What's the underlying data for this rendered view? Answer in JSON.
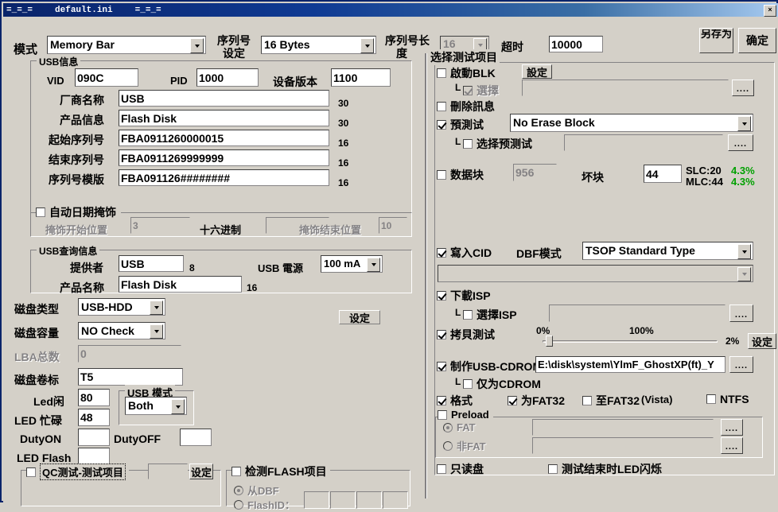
{
  "window": {
    "title_deco_left": "=_=_=",
    "title": "default.ini",
    "title_deco_right": "=_=_=",
    "close_label": "×"
  },
  "topbar": {
    "mode_label": "模式",
    "mode_value": "Memory Bar",
    "serial_device_label": "序列号设定",
    "serial_device_label_l1": "序列号",
    "serial_device_label_l2": "设定",
    "serial_device_value": "16 Bytes",
    "serial_len_label_l1": "序列号长",
    "serial_len_label_l2": "度",
    "serial_len_value": "16",
    "timeout_label": "超时",
    "timeout_value": "10000",
    "saveas_label": "另存为",
    "ok_label": "确定"
  },
  "usb_info": {
    "group_title": "USB信息",
    "vid_label": "VID",
    "vid_value": "090C",
    "pid_label": "PID",
    "pid_value": "1000",
    "devver_label": "设备版本",
    "devver_value": "1100",
    "rows": [
      {
        "label": "厂商名称",
        "value": "USB",
        "len": "30"
      },
      {
        "label": "产品信息",
        "value": "Flash Disk",
        "len": "30"
      },
      {
        "label": "起始序列号",
        "value": "FBA0911260000015",
        "len": "16"
      },
      {
        "label": "结束序列号",
        "value": "FBA0911269999999",
        "len": "16"
      },
      {
        "label": "序列号模版",
        "value": "FBA091126########",
        "len": "16"
      }
    ],
    "auto_date_mask_label": "自动日期掩饰",
    "auto_date_mask_checked": false,
    "mask_start_label": "掩饰开始位置",
    "mask_start_value": "3",
    "hex_label": "十六进制",
    "hex_value": "",
    "mask_end_label": "掩饰结束位置",
    "mask_end_value": "10"
  },
  "usb_query": {
    "group_title": "USB查询信息",
    "vendor_label": "提供者",
    "vendor_value": "USB",
    "vendor_len": "8",
    "product_label": "产品名称",
    "product_value": "Flash Disk",
    "product_len": "16",
    "power_label": "USB 電源",
    "power_value": "100 mA"
  },
  "disk": {
    "type_label": "磁盘类型",
    "type_value": "USB-HDD",
    "capacity_label": "磁盘容量",
    "capacity_value": "NO Check",
    "setting_button": "设定",
    "lba_label": "LBA总数",
    "lba_value": "0",
    "volume_label": "磁盘卷标",
    "volume_value": "T5",
    "led_idle_label": "Led闲",
    "led_idle_value": "80",
    "led_busy_label": "LED 忙碌",
    "led_busy_value": "48",
    "duty_on_label": "DutyON",
    "duty_on_value": "",
    "duty_off_label": "DutyOFF",
    "duty_off_value": "",
    "led_flash_label": "LED Flash",
    "led_flash_value": "",
    "usb_mode_group": "USB 模式",
    "usb_mode_value": "Both"
  },
  "qc": {
    "label": "QC测试-测试项目",
    "checked": false,
    "value": "",
    "setting_button": "设定"
  },
  "flash_detect": {
    "label": "检测FLASH项目",
    "checked": false,
    "from_dbf_label": "从DBF",
    "from_dbf_selected": true,
    "flashid_label": "FlashID：",
    "flashid_selected": false,
    "flashid_values": [
      "",
      "",
      "",
      ""
    ]
  },
  "test_items": {
    "group_title": "选择测试项目",
    "start_blk_label": "啟動BLK",
    "start_blk_checked": false,
    "start_blk_setting": "設定",
    "start_blk_path": "",
    "choose_label": "選擇",
    "choose_checked": true,
    "del_msg_label": "刪除訊息",
    "del_msg_checked": false,
    "pretest_label": "預測试",
    "pretest_checked": true,
    "pretest_value": "No Erase Block",
    "pretest_select_label": "选择预测试",
    "pretest_select_checked": false,
    "pretest_select_path": "",
    "browse_label": "....",
    "data_block_label": "数据块",
    "data_block_checked": false,
    "data_block_value": "956",
    "bad_block_label": "坏块",
    "bad_block_value": "44",
    "slc_label": "SLC:20",
    "slc_pct": "4.3%",
    "mlc_label": "MLC:44",
    "mlc_pct": "4.3%",
    "write_cid_label": "寫入CID",
    "write_cid_checked": true,
    "dbf_mode_label": "DBF模式",
    "dbf_mode_value": "TSOP Standard Type",
    "dbf_extra_value": "",
    "download_isp_label": "下載ISP",
    "download_isp_checked": true,
    "select_isp_label": "選擇ISP",
    "select_isp_checked": false,
    "select_isp_path": "",
    "copy_test_label": "拷貝測试",
    "copy_test_checked": true,
    "slider_min_label": "0%",
    "slider_max_label": "100%",
    "slider_value_label": "2%",
    "slider_value": 2,
    "copy_setting_button": "设定",
    "make_cdrom_label": "制作USB-CDROM",
    "make_cdrom_checked": true,
    "cdrom_path": "E:\\disk\\system\\YlmF_GhostXP(ft)_Y",
    "only_cdrom_label": "仅为CDROM",
    "only_cdrom_checked": false,
    "format_label": "格式",
    "format_checked": true,
    "to_fat32_label": "为FAT32",
    "to_fat32_checked": true,
    "to_fat32_vista_label": "至FAT32",
    "vista_label": "(Vista)",
    "to_fat32_vista_checked": false,
    "ntfs_label": "NTFS",
    "ntfs_checked": false,
    "preload_label": "Preload",
    "preload_checked": false,
    "fat_label": "FAT",
    "fat_selected": true,
    "nonfat_label": "非FAT",
    "nonfat_selected": false,
    "fat_path": "",
    "nonfat_path": "",
    "readonly_label": "只读盘",
    "readonly_checked": false,
    "led_blink_label": "测试结束时LED闪烁",
    "led_blink_checked": false
  },
  "colors": {
    "titlebar": "#0a246a",
    "face": "#d4d0c8",
    "green": "#00a000"
  }
}
